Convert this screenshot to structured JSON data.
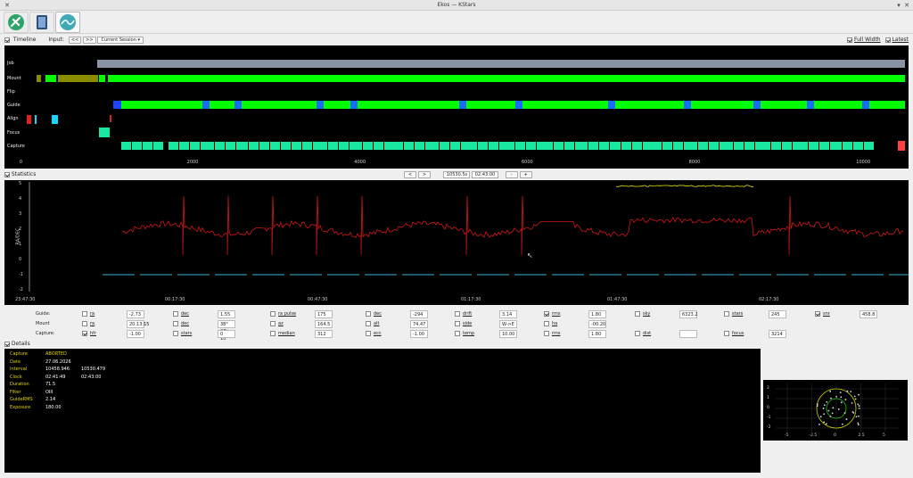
{
  "window": {
    "title": "Ekos — KStars"
  },
  "tabs": [
    {
      "name": "setup-tab",
      "active": false
    },
    {
      "name": "manager-tab",
      "active": false
    },
    {
      "name": "analyze-tab",
      "active": true
    }
  ],
  "timeline": {
    "checkbox_label": "Timeline",
    "input_label": "Input:",
    "nav_back": "<<",
    "nav_fwd": ">>",
    "session": "Current Session",
    "full_width": "Full Width",
    "latest": "Latest",
    "rows": [
      "Job",
      "Mount",
      "Flip",
      "Guide",
      "Align",
      "Focus",
      "Capture"
    ],
    "ticks": [
      "0",
      "2000",
      "4000",
      "6000",
      "8000",
      "10000"
    ]
  },
  "statistics": {
    "checkbox_label": "Statistics",
    "nav": [
      "<",
      ">"
    ],
    "time": "10530.5s",
    "clock": "02:43:00",
    "zoom": [
      "-",
      "+"
    ],
    "y_label": "RA/DEC",
    "y_ticks": [
      "5",
      "4",
      "3",
      "2",
      "1",
      "0",
      "-1",
      "-2"
    ],
    "x_ticks": [
      "23:47:30",
      "00:17:30",
      "00:47:30",
      "01:17:30",
      "01:47:30",
      "02:17:30"
    ]
  },
  "stats_rows": [
    {
      "label": "Guide:",
      "items": [
        {
          "name": "ra",
          "checked": false,
          "value": "-2.73"
        },
        {
          "name": "dec",
          "checked": false,
          "value": "1.55"
        },
        {
          "name": "ra pulse",
          "checked": false,
          "value": "175"
        },
        {
          "name": "dec",
          "checked": false,
          "value": "-294"
        },
        {
          "name": "drift",
          "checked": false,
          "value": "3.14"
        },
        {
          "name": "rms",
          "checked": true,
          "value": "1.80"
        },
        {
          "name": "sky",
          "checked": false,
          "value": "6323.2"
        },
        {
          "name": "stars",
          "checked": false,
          "value": "245"
        },
        {
          "name": "snr",
          "checked": true,
          "value": "458.8"
        }
      ]
    },
    {
      "label": "Mount",
      "items": [
        {
          "name": "ra",
          "checked": false,
          "value": "20:13:15"
        },
        {
          "name": "dec",
          "checked": false,
          "value": "38° 27' 10\""
        },
        {
          "name": "az",
          "checked": false,
          "value": "164.5"
        },
        {
          "name": "alt",
          "checked": false,
          "value": "74.47"
        },
        {
          "name": "side",
          "checked": false,
          "value": "W->E"
        },
        {
          "name": "ha",
          "checked": false,
          "value": "-00:20"
        }
      ]
    },
    {
      "label": "Capture:",
      "items": [
        {
          "name": "hfr",
          "checked": true,
          "value": "-1.00"
        },
        {
          "name": "stars",
          "checked": false,
          "value": "0"
        },
        {
          "name": "median",
          "checked": false,
          "value": "312"
        },
        {
          "name": "ecc",
          "checked": false,
          "value": "-1.00"
        },
        {
          "name": "temp",
          "checked": false,
          "value": "10.00"
        },
        {
          "name": "rms",
          "checked": false,
          "value": "1.80"
        },
        {
          "name": "dist",
          "checked": false,
          "value": ""
        },
        {
          "name": "focus",
          "checked": false,
          "value": "3214"
        }
      ]
    }
  ],
  "details": {
    "checkbox_label": "Details",
    "rows": [
      {
        "key": "Capture",
        "v1": "ABORTED",
        "v2": ""
      },
      {
        "key": "Date",
        "v1": "27.06.2026",
        "v2": ""
      },
      {
        "key": "Interval",
        "v1": "10458.946",
        "v2": "10530.479"
      },
      {
        "key": "Clock",
        "v1": "02:41:49",
        "v2": "02:43:00"
      },
      {
        "key": "Duration",
        "v1": "71.5",
        "v2": ""
      },
      {
        "key": "Filter",
        "v1": "OIII",
        "v2": ""
      },
      {
        "key": "GuideRMS",
        "v1": "2.14",
        "v2": ""
      },
      {
        "key": "Exposure",
        "v1": "180.00",
        "v2": ""
      }
    ]
  },
  "scatter": {
    "x_ticks": [
      "-5",
      "-2.5",
      "0",
      "2.5",
      "5"
    ],
    "y_ticks": [
      "2",
      "1",
      "0",
      "-1",
      "-2"
    ]
  },
  "colors": {
    "green": "#00ff00",
    "olive": "#8b8b00",
    "blue": "#1d45ff",
    "cyan": "#1ad3ff",
    "gray": "#8a93a3",
    "red": "#d22",
    "capture": "#19e8a0",
    "yellow": "#e8e800"
  }
}
